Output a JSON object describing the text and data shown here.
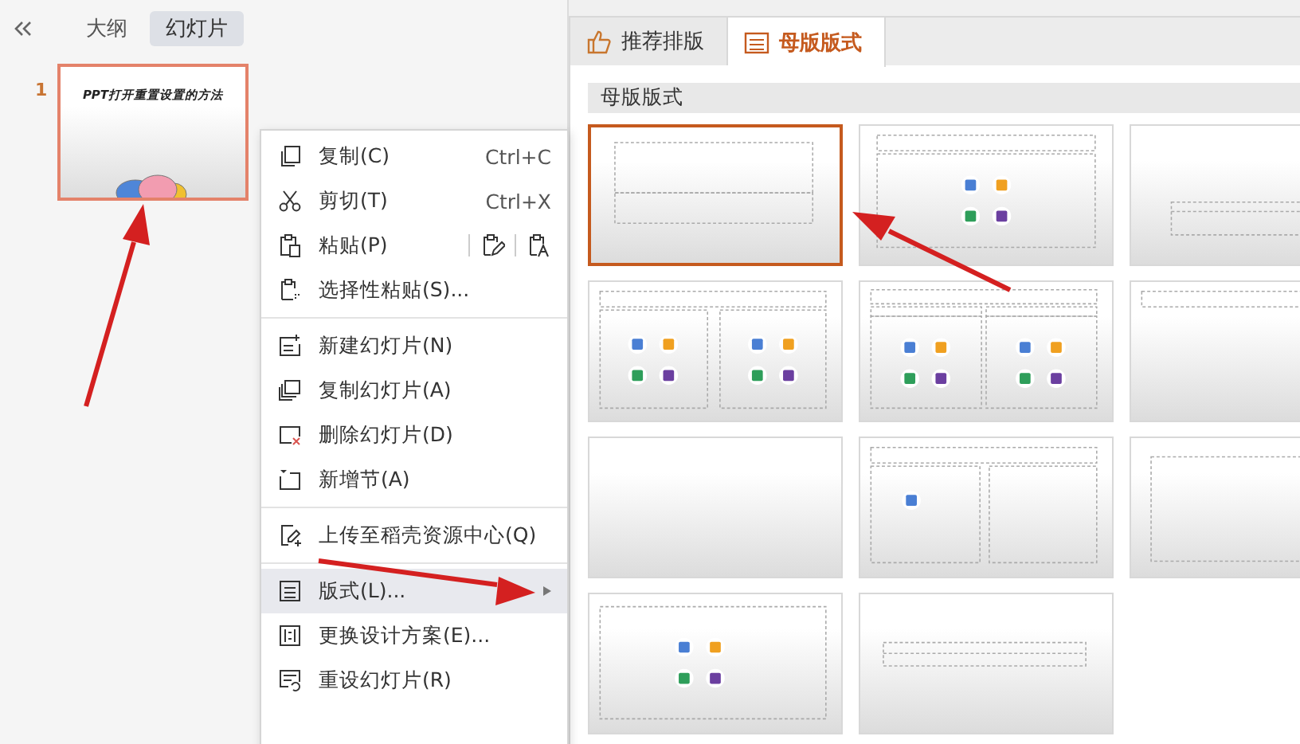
{
  "left_pane": {
    "tabs": [
      {
        "label": "大纲",
        "selected": false
      },
      {
        "label": "幻灯片",
        "selected": true
      }
    ],
    "slides": [
      {
        "number": "1",
        "title": "PPT打开重置设置的方法",
        "selected": true
      }
    ]
  },
  "context_menu": {
    "groups": [
      [
        {
          "kind": "plain",
          "label": "复制(C)",
          "shortcut": "Ctrl+C",
          "selected": false
        },
        {
          "kind": "plain",
          "label": "剪切(T)",
          "shortcut": "Ctrl+X",
          "selected": false
        },
        {
          "kind": "paste",
          "label": "粘贴(P)",
          "selected": false
        },
        {
          "kind": "plain",
          "label": "选择性粘贴(S)...",
          "selected": false
        }
      ],
      [
        {
          "kind": "plain",
          "label": "新建幻灯片(N)",
          "selected": false
        },
        {
          "kind": "plain",
          "label": "复制幻灯片(A)",
          "selected": false
        },
        {
          "kind": "plain",
          "label": "删除幻灯片(D)",
          "selected": false
        },
        {
          "kind": "plain",
          "label": "新增节(A)",
          "selected": false
        }
      ],
      [
        {
          "kind": "plain",
          "label": "上传至稻壳资源中心(Q)",
          "selected": false
        }
      ],
      [
        {
          "kind": "submenu",
          "label": "版式(L)...",
          "selected": true
        },
        {
          "kind": "plain",
          "label": "更换设计方案(E)...",
          "selected": false
        },
        {
          "kind": "plain",
          "label": "重设幻灯片(R)",
          "selected": false
        }
      ]
    ]
  },
  "right_panel": {
    "tabs": [
      {
        "label": "推荐排版",
        "selected": false
      },
      {
        "label": "母版版式",
        "selected": true
      }
    ],
    "section_title": "母版版式",
    "layouts": [
      {
        "kind": "title-slide",
        "selected": true
      },
      {
        "kind": "title-content",
        "selected": false
      },
      {
        "kind": "section-header",
        "selected": false
      },
      {
        "kind": "two-content",
        "selected": false
      },
      {
        "kind": "comparison",
        "selected": false
      },
      {
        "kind": "title-only",
        "selected": false
      },
      {
        "kind": "blank",
        "selected": false
      },
      {
        "kind": "picture-caption",
        "selected": false
      },
      {
        "kind": "content-box",
        "selected": false
      },
      {
        "kind": "content",
        "selected": false
      },
      {
        "kind": "caption",
        "selected": false
      }
    ]
  }
}
